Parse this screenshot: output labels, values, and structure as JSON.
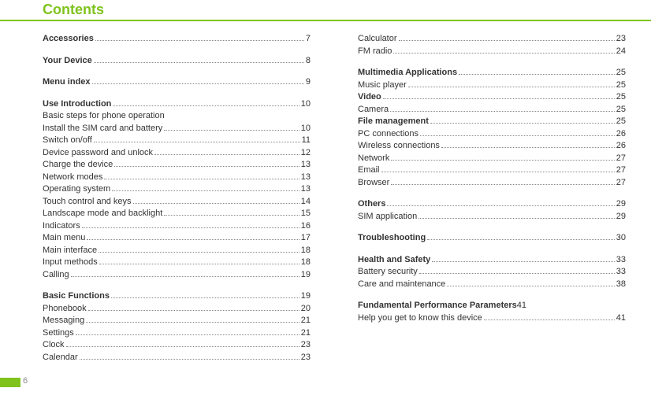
{
  "page_number": "6",
  "title": "Contents",
  "entries": [
    {
      "type": "link",
      "bold": true,
      "label": "Accessories",
      "page": "7"
    },
    {
      "type": "spacer"
    },
    {
      "type": "link",
      "bold": true,
      "label": "Your Device",
      "page": "8"
    },
    {
      "type": "spacer"
    },
    {
      "type": "link",
      "bold": true,
      "label": "Menu index",
      "page": "9"
    },
    {
      "type": "spacer"
    },
    {
      "type": "link",
      "bold": true,
      "label": "Use Introduction",
      "page": "10"
    },
    {
      "type": "note",
      "label": "Basic steps for phone operation"
    },
    {
      "type": "link",
      "bold": false,
      "label": "Install the SIM card and battery",
      "page": "10"
    },
    {
      "type": "link",
      "bold": false,
      "label": "Switch on/off",
      "page": "11"
    },
    {
      "type": "link",
      "bold": false,
      "label": "Device password and unlock",
      "page": "12"
    },
    {
      "type": "link",
      "bold": false,
      "label": "Charge the device",
      "page": "13"
    },
    {
      "type": "link",
      "bold": false,
      "label": "Network modes",
      "page": "13"
    },
    {
      "type": "link",
      "bold": false,
      "label": "Operating system",
      "page": "13"
    },
    {
      "type": "link",
      "bold": false,
      "label": "Touch control and keys",
      "page": "14"
    },
    {
      "type": "link",
      "bold": false,
      "label": "Landscape mode and backlight",
      "page": "15"
    },
    {
      "type": "link",
      "bold": false,
      "label": "Indicators",
      "page": "16"
    },
    {
      "type": "link",
      "bold": false,
      "label": "Main menu",
      "page": "17"
    },
    {
      "type": "link",
      "bold": false,
      "label": "Main interface",
      "page": "18"
    },
    {
      "type": "link",
      "bold": false,
      "label": "Input methods",
      "page": "18"
    },
    {
      "type": "link",
      "bold": false,
      "label": "Calling",
      "page": "19"
    },
    {
      "type": "spacer"
    },
    {
      "type": "link",
      "bold": true,
      "label": "Basic Functions",
      "page": "19"
    },
    {
      "type": "link",
      "bold": false,
      "label": "Phonebook",
      "page": "20"
    },
    {
      "type": "link",
      "bold": false,
      "label": "Messaging",
      "page": "21"
    },
    {
      "type": "link",
      "bold": false,
      "label": "Settings",
      "page": "21"
    },
    {
      "type": "link",
      "bold": false,
      "label": "Clock",
      "page": "23"
    },
    {
      "type": "link",
      "bold": false,
      "label": "Calendar",
      "page": "23"
    },
    {
      "type": "link",
      "bold": false,
      "label": "Calculator",
      "page": "23"
    },
    {
      "type": "link",
      "bold": false,
      "label": "FM radio",
      "page": "24"
    },
    {
      "type": "spacer"
    },
    {
      "type": "link",
      "bold": true,
      "label": "Multimedia Applications",
      "page": "25"
    },
    {
      "type": "link",
      "bold": false,
      "label": "Music player",
      "page": "25"
    },
    {
      "type": "link",
      "bold": true,
      "label": "Video",
      "page": "25"
    },
    {
      "type": "link",
      "bold": false,
      "label": "Camera",
      "page": "25"
    },
    {
      "type": "link",
      "bold": true,
      "label": "File management",
      "page": "25"
    },
    {
      "type": "link",
      "bold": false,
      "label": "PC connections",
      "page": "26"
    },
    {
      "type": "link",
      "bold": false,
      "label": "Wireless connections",
      "page": "26"
    },
    {
      "type": "link",
      "bold": false,
      "label": "Network",
      "page": "27"
    },
    {
      "type": "link",
      "bold": false,
      "label": "Email",
      "page": "27"
    },
    {
      "type": "link",
      "bold": false,
      "label": "Browser",
      "page": "27"
    },
    {
      "type": "spacer"
    },
    {
      "type": "link",
      "bold": true,
      "label": "Others",
      "page": "29"
    },
    {
      "type": "link",
      "bold": false,
      "label": "SIM application",
      "page": "29"
    },
    {
      "type": "spacer"
    },
    {
      "type": "link",
      "bold": true,
      "label": "Troubleshooting",
      "page": "30"
    },
    {
      "type": "spacer"
    },
    {
      "type": "link",
      "bold": true,
      "label": "Health and Safety",
      "page": "33"
    },
    {
      "type": "link",
      "bold": false,
      "label": "Battery security",
      "page": "33"
    },
    {
      "type": "link",
      "bold": false,
      "label": "Care and maintenance",
      "page": "38"
    },
    {
      "type": "spacer"
    },
    {
      "type": "link",
      "bold": true,
      "nodots": true,
      "label": "Fundamental Performance Parameters",
      "page": "41"
    },
    {
      "type": "link",
      "bold": false,
      "label": "Help you get to know this device",
      "page": "41"
    }
  ]
}
